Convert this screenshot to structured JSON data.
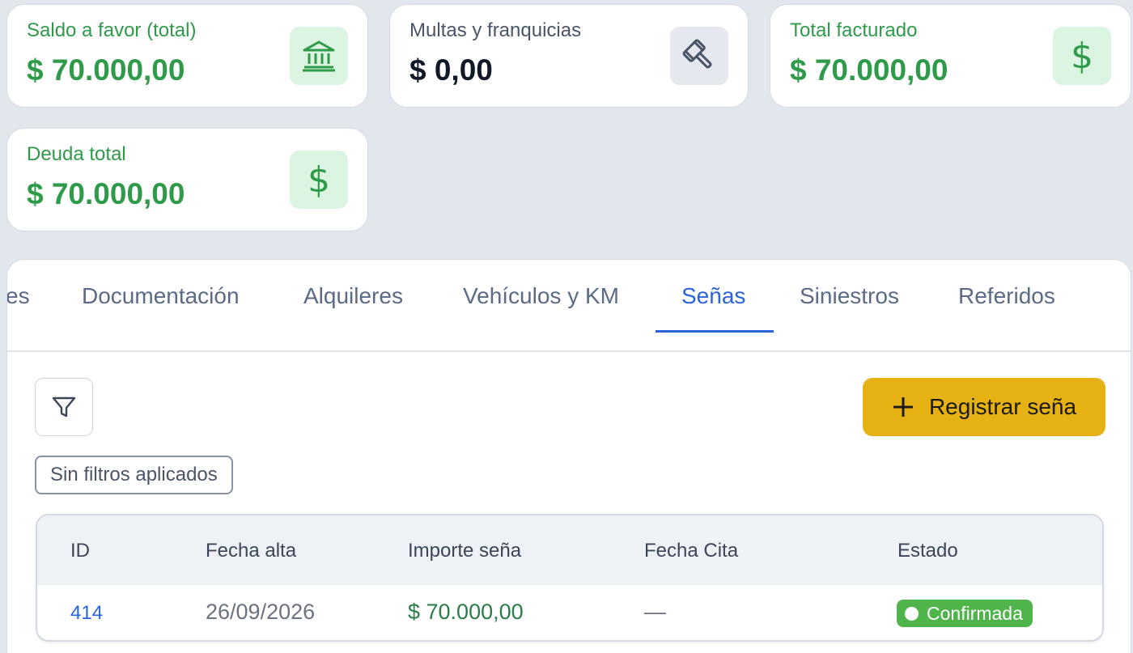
{
  "summary_cards": [
    {
      "label": "Saldo a favor (total)",
      "value": "$ 70.000,00",
      "icon": "bank-icon"
    },
    {
      "label": "Multas y franquicias",
      "value": "$ 0,00",
      "icon": "gavel-icon"
    },
    {
      "label": "Total facturado",
      "value": "$ 70.000,00",
      "icon": "dollar-icon"
    },
    {
      "label": "Deuda total",
      "value": "$ 70.000,00",
      "icon": "dollar-icon"
    }
  ],
  "icons": {
    "dollar": "$"
  },
  "tabs": [
    {
      "label": "es"
    },
    {
      "label": "Documentación"
    },
    {
      "label": "Alquileres"
    },
    {
      "label": "Vehículos y KM"
    },
    {
      "label": "Señas",
      "active": true
    },
    {
      "label": "Siniestros"
    },
    {
      "label": "Referidos"
    }
  ],
  "toolbar": {
    "add_label": "Registrar seña",
    "filter_chip": "Sin filtros aplicados"
  },
  "table": {
    "columns": [
      "ID",
      "Fecha alta",
      "Importe seña",
      "Fecha Cita",
      "Estado"
    ],
    "rows": [
      {
        "id": "414",
        "fecha_alta": "26/09/2026",
        "importe": "$ 70.000,00",
        "fecha_cita": "—",
        "estado": "Confirmada"
      }
    ]
  },
  "colors": {
    "accent_green": "#2f9b4a",
    "primary_blue": "#2b63d9",
    "action_yellow": "#e6b112",
    "status_green": "#4fb54b"
  }
}
